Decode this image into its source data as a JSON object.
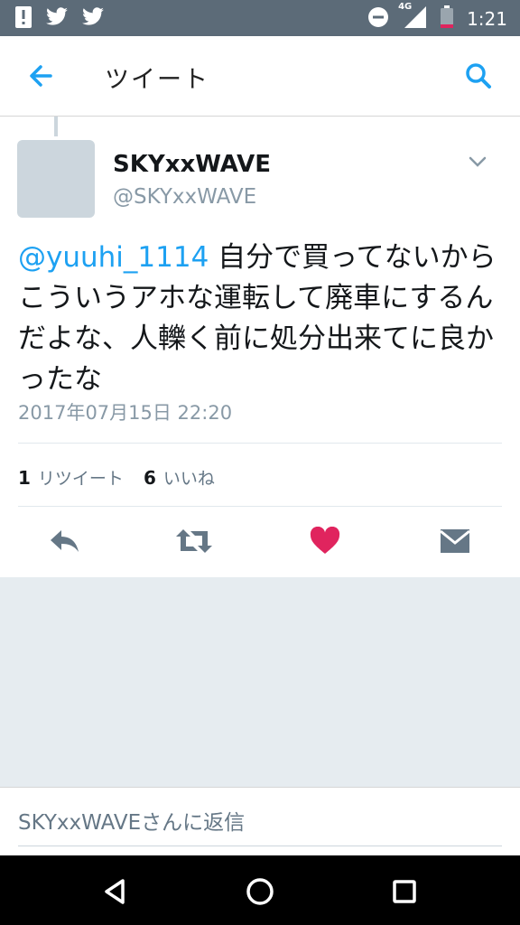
{
  "status_bar": {
    "time": "1:21",
    "network": "4G",
    "left_icons": [
      "alert-icon",
      "twitter-bird-icon",
      "twitter-bird-icon"
    ],
    "right_icons": [
      "do-not-disturb-icon",
      "signal-icon",
      "battery-icon"
    ]
  },
  "app_bar": {
    "title": "ツイート",
    "back_icon": "arrow-left-icon",
    "search_icon": "search-icon"
  },
  "tweet": {
    "display_name": "SKYxxWAVE",
    "handle": "@SKYxxWAVE",
    "mention": "@yuuhi_1114",
    "text": "自分で買ってないからこういうアホな運転して廃車にするんだよな、人轢く前に処分出来てに良かったな",
    "timestamp": "2017年07月15日 22:20",
    "retweet_count": "1",
    "retweet_label": "リツイート",
    "like_count": "6",
    "like_label": "いいね"
  },
  "actions": [
    "reply-icon",
    "retweet-icon",
    "heart-icon",
    "message-icon"
  ],
  "reply_box": {
    "placeholder": "SKYxxWAVEさんに返信"
  },
  "colors": {
    "accent": "#1da1f2",
    "like": "#e0245e",
    "icon_gray": "#657786",
    "status_bar": "#5c6b78"
  }
}
